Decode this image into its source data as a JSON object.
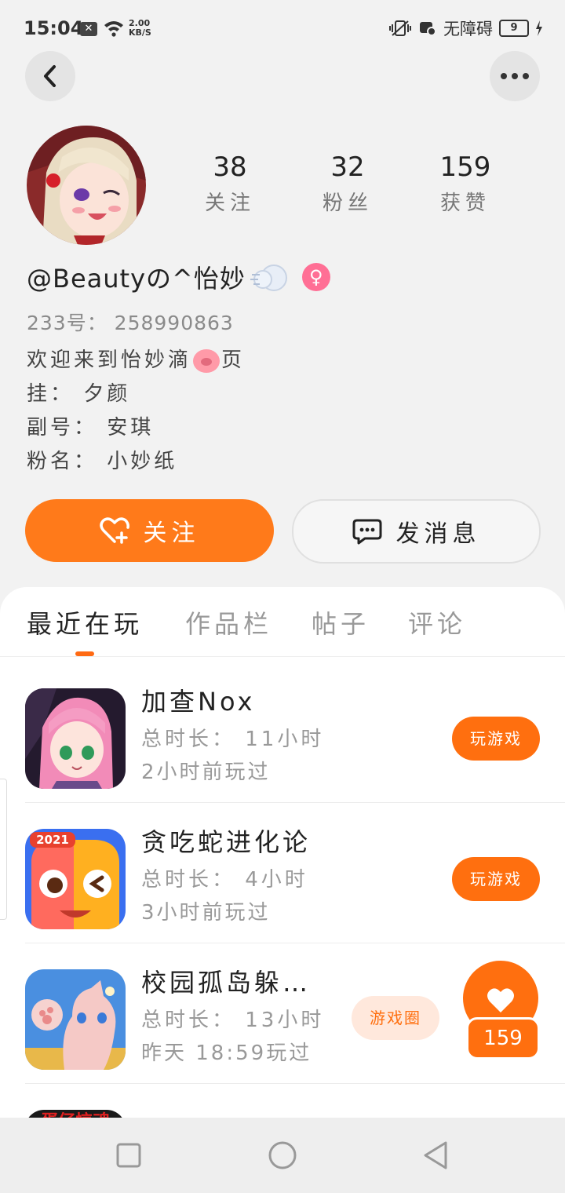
{
  "status_bar": {
    "time": "15:04",
    "net_speed_value": "2.00",
    "net_speed_unit": "KB/S",
    "accessibility_label": "无障碍",
    "battery": "9"
  },
  "profile": {
    "stats": [
      {
        "value": "38",
        "label": "关注"
      },
      {
        "value": "32",
        "label": "粉丝"
      },
      {
        "value": "159",
        "label": "获赞"
      }
    ],
    "username": "@Beautyの^怡妙",
    "gender_symbol": "♀",
    "uid": "233号： 258990863",
    "bio": {
      "line1_before": "欢迎来到怡妙滴",
      "line1_after": "页",
      "line2": "挂： 夕颜",
      "line3": "副号： 安琪",
      "line4": "粉名： 小妙纸"
    }
  },
  "actions": {
    "follow_label": "关注",
    "message_label": "发消息"
  },
  "tabs": [
    "最近在玩",
    "作品栏",
    "帖子",
    "评论"
  ],
  "games": [
    {
      "name": "加查Nox",
      "total_time": "总时长： 11小时",
      "last_played": "2小时前玩过",
      "button": "玩游戏"
    },
    {
      "name": "贪吃蛇进化论",
      "total_time": "总时长： 4小时",
      "last_played": "3小时前玩过",
      "button": "玩游戏"
    },
    {
      "name": "校园孤岛躲…",
      "total_time": "总时长： 13小时",
      "last_played": "昨天 18:59玩过",
      "button": "游戏圈"
    }
  ],
  "icons": {
    "game2_badge": "2021",
    "game4_text": "蛋仔惊魂"
  },
  "float_like": {
    "count": "159"
  },
  "colors": {
    "accent": "#ff6f0f",
    "gender": "#ff6f95"
  }
}
